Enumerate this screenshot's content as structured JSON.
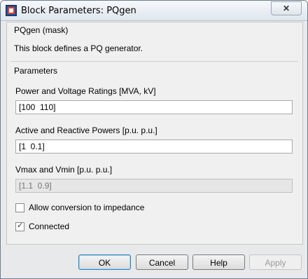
{
  "window": {
    "title": "Block Parameters: PQgen",
    "close_glyph": "✕"
  },
  "mask": {
    "header": "PQgen (mask)",
    "description": "This block defines a PQ generator."
  },
  "parameters": {
    "header": "Parameters",
    "fields": [
      {
        "label": "Power and Voltage Ratings [MVA, kV]",
        "value": "[100  110]",
        "enabled": true
      },
      {
        "label": "Active and Reactive Powers [p.u.  p.u.]",
        "value": "[1  0.1]",
        "enabled": true
      },
      {
        "label": "Vmax and Vmin [p.u.  p.u.]",
        "value": "[1.1  0.9]",
        "enabled": false
      }
    ],
    "checkboxes": [
      {
        "label": "Allow conversion to impedance",
        "checked": false
      },
      {
        "label": "Connected",
        "checked": true
      }
    ]
  },
  "buttons": {
    "ok": "OK",
    "cancel": "Cancel",
    "help": "Help",
    "apply": "Apply"
  },
  "colors": {
    "accent": "#3c7fb1"
  }
}
